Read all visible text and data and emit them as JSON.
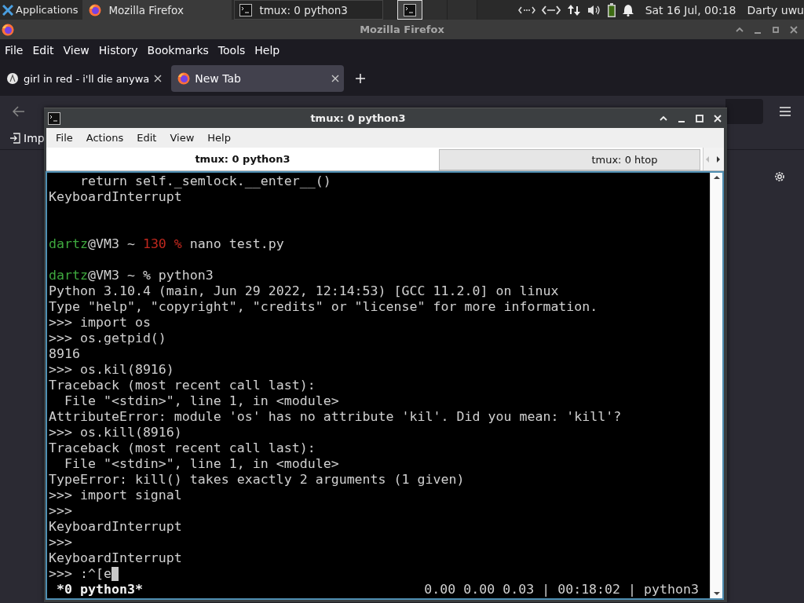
{
  "panel": {
    "apps_label": "Applications",
    "tasks": [
      {
        "label": "Mozilla Firefox",
        "kind": "browser",
        "selected": false
      },
      {
        "label": "tmux: 0 python3",
        "kind": "terminal",
        "selected": true
      }
    ],
    "clock": "Sat 16 Jul, 00:18",
    "user": "Darty uwu"
  },
  "browser": {
    "title": "Mozilla Firefox",
    "menu": [
      "File",
      "Edit",
      "View",
      "History",
      "Bookmarks",
      "Tools",
      "Help"
    ],
    "tabs": [
      {
        "label": "girl in red - i'll die anywa",
        "kind": "site",
        "selected": false
      },
      {
        "label": "New Tab",
        "kind": "browser",
        "selected": true
      }
    ],
    "bookmarks": [
      {
        "label": "Imp"
      }
    ]
  },
  "terminal": {
    "title": "tmux: 0 python3",
    "menu": [
      "File",
      "Actions",
      "Edit",
      "View",
      "Help"
    ],
    "tabs": [
      {
        "label": "tmux: 0 python3",
        "selected": true
      },
      {
        "label": "tmux: 0 htop",
        "selected": false
      }
    ],
    "lines": [
      {
        "kind": "text",
        "text": "    return self._semlock.__enter__()"
      },
      {
        "kind": "text",
        "text": "KeyboardInterrupt"
      },
      {
        "kind": "blank"
      },
      {
        "kind": "blank"
      },
      {
        "kind": "prompt",
        "segments": [
          {
            "text": "dartz",
            "color": "#3ea83e"
          },
          {
            "text": "@VM3 ~ ",
            "color": "#d0d0d0"
          },
          {
            "text": "130 %",
            "color": "#c0281e"
          },
          {
            "text": " nano test.py",
            "color": "#d0d0d0"
          }
        ]
      },
      {
        "kind": "blank"
      },
      {
        "kind": "prompt",
        "segments": [
          {
            "text": "dartz",
            "color": "#3ea83e"
          },
          {
            "text": "@VM3 ~ % python3",
            "color": "#d0d0d0"
          }
        ]
      },
      {
        "kind": "text",
        "text": "Python 3.10.4 (main, Jun 29 2022, 12:14:53) [GCC 11.2.0] on linux"
      },
      {
        "kind": "text",
        "text": "Type \"help\", \"copyright\", \"credits\" or \"license\" for more information."
      },
      {
        "kind": "text",
        "text": ">>> import os"
      },
      {
        "kind": "text",
        "text": ">>> os.getpid()"
      },
      {
        "kind": "text",
        "text": "8916"
      },
      {
        "kind": "text",
        "text": ">>> os.kil(8916)"
      },
      {
        "kind": "text",
        "text": "Traceback (most recent call last):"
      },
      {
        "kind": "text",
        "text": "  File \"<stdin>\", line 1, in <module>"
      },
      {
        "kind": "text",
        "text": "AttributeError: module 'os' has no attribute 'kil'. Did you mean: 'kill'?"
      },
      {
        "kind": "text",
        "text": ">>> os.kill(8916)"
      },
      {
        "kind": "text",
        "text": "Traceback (most recent call last):"
      },
      {
        "kind": "text",
        "text": "  File \"<stdin>\", line 1, in <module>"
      },
      {
        "kind": "text",
        "text": "TypeError: kill() takes exactly 2 arguments (1 given)"
      },
      {
        "kind": "text",
        "text": ">>> import signal"
      },
      {
        "kind": "text",
        "text": ">>>"
      },
      {
        "kind": "text",
        "text": "KeyboardInterrupt"
      },
      {
        "kind": "text",
        "text": ">>>"
      },
      {
        "kind": "text",
        "text": "KeyboardInterrupt"
      },
      {
        "kind": "input",
        "text": ">>> :^[e",
        "cursor": true
      }
    ],
    "status_left": "*0 python3*",
    "status_right": "0.00 0.00 0.03 | 00:18:02 | python3"
  }
}
